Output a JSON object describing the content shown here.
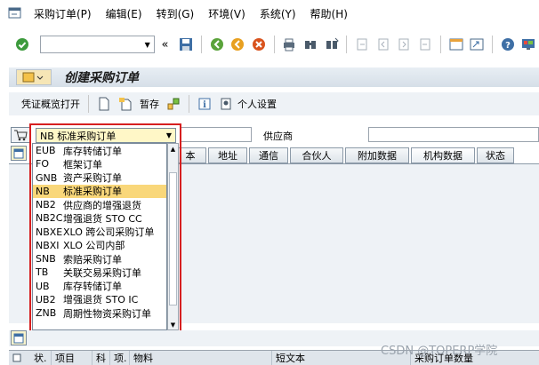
{
  "menu": {
    "items": [
      "采购订单(P)",
      "编辑(E)",
      "转到(G)",
      "环境(V)",
      "系统(Y)",
      "帮助(H)"
    ]
  },
  "toolbar": {
    "command_value": ""
  },
  "screen": {
    "title": "创建采购订单"
  },
  "app_toolbar": {
    "overview_label": "凭证概览打开",
    "hold_label": "暂存",
    "personal_settings_label": "个人设置"
  },
  "header": {
    "po_type_value": "NB 标准采购订单",
    "supplier_label": "供应商"
  },
  "tabs": [
    {
      "label": "本",
      "active": false
    },
    {
      "label": "地址",
      "active": false
    },
    {
      "label": "通信",
      "active": false
    },
    {
      "label": "合伙人",
      "active": false
    },
    {
      "label": "附加数据",
      "active": false
    },
    {
      "label": "机构数据",
      "active": true
    },
    {
      "label": "状态",
      "active": false
    }
  ],
  "po_type_options": [
    {
      "code": "EUB",
      "text": "库存转储订单"
    },
    {
      "code": "FO",
      "text": "框架订单"
    },
    {
      "code": "GNB",
      "text": "资产采购订单"
    },
    {
      "code": "NB",
      "text": "标准采购订单",
      "selected": true
    },
    {
      "code": "NB2",
      "text": "供应商的增强退货"
    },
    {
      "code": "NB2C",
      "text": "增强退货 STO CC"
    },
    {
      "code": "NBXE",
      "text": "XLO 跨公司采购订单"
    },
    {
      "code": "NBXI",
      "text": "XLO 公司内部"
    },
    {
      "code": "SNB",
      "text": "索赔采购订单"
    },
    {
      "code": "TB",
      "text": "关联交易采购订单"
    },
    {
      "code": "UB",
      "text": "库存转储订单"
    },
    {
      "code": "UB2",
      "text": "增强退货 STO IC"
    },
    {
      "code": "ZNB",
      "text": "周期性物资采购订单"
    }
  ],
  "items_table": {
    "columns": [
      "状.",
      "项目",
      "科",
      "项.",
      "物料",
      "短文本",
      "采购订单数量"
    ]
  },
  "watermark": "CSDN @TOPERP学院"
}
